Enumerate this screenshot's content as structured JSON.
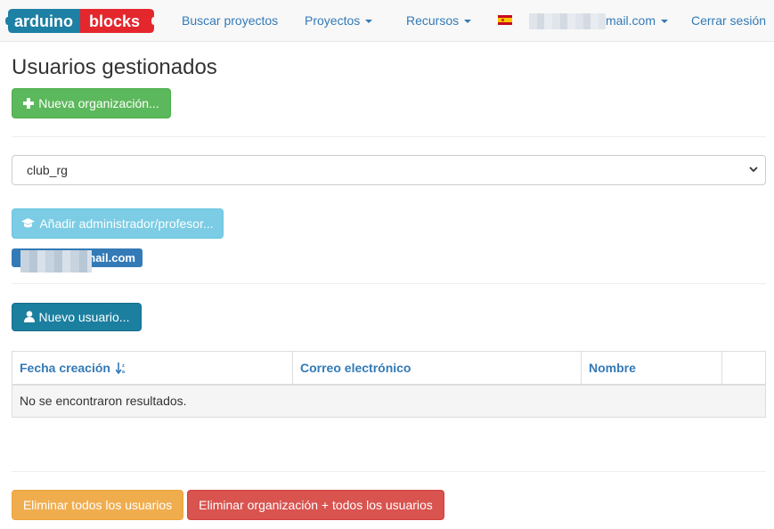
{
  "nav": {
    "logo_text_left": "arduino",
    "logo_text_right": "blocks",
    "items": [
      {
        "label": "Buscar proyectos"
      },
      {
        "label": "Proyectos"
      },
      {
        "label": "Recursos"
      }
    ],
    "account_email_suffix": "mail.com",
    "logout": "Cerrar sesión"
  },
  "page": {
    "title": "Usuarios gestionados",
    "new_org_button": "Nueva organización..."
  },
  "org_select": {
    "selected": "club_rg"
  },
  "admins": {
    "add_admin_button": "Añadir administrador/profesor...",
    "admin_email_suffix": "mail.com"
  },
  "users": {
    "new_user_button": "Nuevo usuario...",
    "table": {
      "columns": [
        "Fecha creación",
        "Correo electrónico",
        "Nombre",
        ""
      ],
      "empty_message": "No se encontraron resultados."
    }
  },
  "footer": {
    "delete_all_users": "Eliminar todos los usuarios",
    "delete_org_and_users": "Eliminar organización + todos los usuarios"
  },
  "colors": {
    "link": "#337ab7",
    "success": "#5cb85c",
    "info": "#5bc0de",
    "primary_dark": "#1b7fa0",
    "warning": "#f0ad4e",
    "danger": "#d9534f",
    "logo_blue": "#1d80a4",
    "logo_red": "#e4262d"
  }
}
